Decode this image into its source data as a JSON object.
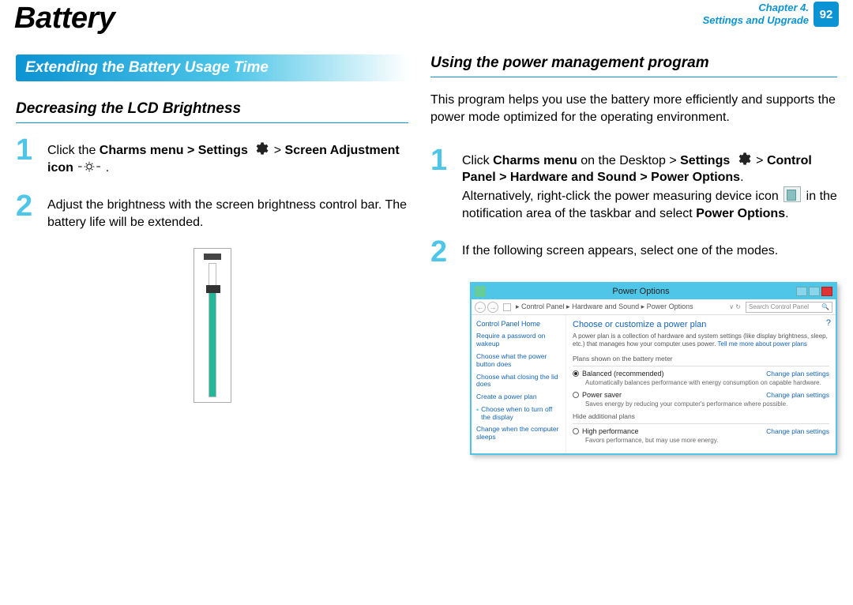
{
  "header": {
    "title": "Battery",
    "chapter_line1": "Chapter 4.",
    "chapter_line2": "Settings and Upgrade",
    "page_number": "92"
  },
  "left": {
    "section_bar": "Extending the Battery Usage Time",
    "subheading": "Decreasing the LCD Brightness",
    "step1": {
      "num": "1",
      "pre": "Click the ",
      "bold1": "Charms menu > Settings",
      "mid": " > ",
      "bold2": "Screen Adjustment icon",
      "post": " ."
    },
    "step2": {
      "num": "2",
      "text": "Adjust the brightness with the screen brightness control bar. The battery life will be extended."
    }
  },
  "right": {
    "subheading": "Using the power management program",
    "intro": "This program helps you use the battery more efficiently and supports the power mode optimized for the operating environment.",
    "step1": {
      "num": "1",
      "l1a": "Click ",
      "l1b": "Charms menu",
      "l1c": " on the Desktop > ",
      "l1d": "Settings",
      "l1e": " > ",
      "l2": "Control Panel > Hardware and Sound > Power Options",
      "l3a": "Alternatively, right-click the power measuring device icon ",
      "l3b": " in the notification area of the taskbar and select ",
      "l3c": "Power Options",
      "l3d": "."
    },
    "step2": {
      "num": "2",
      "text": "If the following screen appears, select one of the modes."
    }
  },
  "po": {
    "title": "Power Options",
    "crumb": "▸ Control Panel ▸ Hardware and Sound ▸ Power Options",
    "search": "Search Control Panel",
    "side_title": "Control Panel Home",
    "side_items": [
      "Require a password on wakeup",
      "Choose what the power button does",
      "Choose what closing the lid does",
      "Create a power plan",
      "Choose when to turn off the display",
      "Change when the computer sleeps"
    ],
    "main_title": "Choose or customize a power plan",
    "main_desc_a": "A power plan is a collection of hardware and system settings (like display brightness, sleep, etc.) that manages how your computer uses power. ",
    "main_desc_link": "Tell me more about power plans",
    "plans_label": "Plans shown on the battery meter",
    "plan1_name": "Balanced (recommended)",
    "plan1_desc": "Automatically balances performance with energy consumption on capable hardware.",
    "plan2_name": "Power saver",
    "plan2_desc": "Saves energy by reducing your computer's performance where possible.",
    "hide_label": "Hide additional plans",
    "plan3_name": "High performance",
    "plan3_desc": "Favors performance, but may use more energy.",
    "change_link": "Change plan settings"
  }
}
